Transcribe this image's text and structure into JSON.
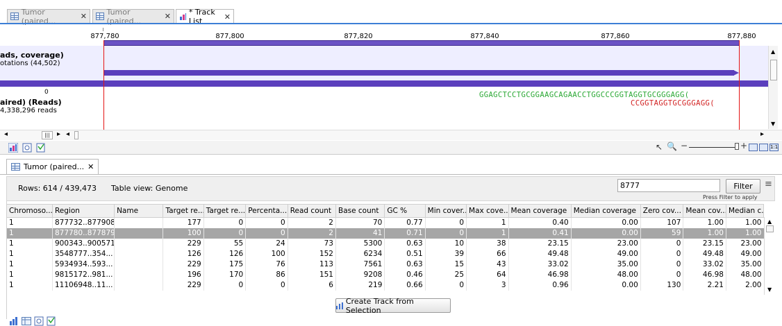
{
  "tabs": [
    {
      "label": "Tumor (paired...",
      "active": false
    },
    {
      "label": "Tumor (paired...",
      "active": false
    },
    {
      "label": "* Track List",
      "active": true
    }
  ],
  "ruler": {
    "ticks": [
      "877,780",
      "877,800",
      "877,820",
      "877,840",
      "877,860",
      "877,880"
    ]
  },
  "coverage_track": {
    "title": "ads, coverage)",
    "subtitle": "otations (44,502)"
  },
  "reads_track": {
    "title": "aired) (Reads)",
    "subtitle": "4,338,296 reads",
    "axis_zero": "0"
  },
  "sequences": {
    "top": "GGAGCTCCTGCGGAAGCAGAACCTGGCCCGGTAGGTGCGGGAGG(",
    "bottom": "CCGGTAGGTGCGGGAGG("
  },
  "lower_tab": {
    "label": "Tumor (paired..."
  },
  "filter_bar": {
    "rows": "Rows: 614 / 439,473",
    "table_view": "Table view: Genome",
    "search_value": "8777",
    "filter_button": "Filter",
    "hint": "Press Filter to apply"
  },
  "table": {
    "columns": [
      "Chromoso...",
      "Region",
      "Name",
      "Target re...",
      "Target re...",
      "Percenta...",
      "Read count",
      "Base count",
      "GC %",
      "Min cover...",
      "Max cove...",
      "Mean coverage",
      "Median coverage",
      "Zero cov...",
      "Mean cov...",
      "Median c..."
    ],
    "rows": [
      [
        "1",
        "877732..877908",
        "",
        "177",
        "0",
        "0",
        "2",
        "70",
        "0.77",
        "0",
        "1",
        "0.40",
        "0.00",
        "107",
        "1.00",
        "1.00"
      ],
      [
        "1",
        "877780..877879",
        "",
        "100",
        "0",
        "0",
        "2",
        "41",
        "0.71",
        "0",
        "1",
        "0.41",
        "0.00",
        "59",
        "1.00",
        "1.00"
      ],
      [
        "1",
        "900343..900571",
        "",
        "229",
        "55",
        "24",
        "73",
        "5300",
        "0.63",
        "10",
        "38",
        "23.15",
        "23.00",
        "0",
        "23.15",
        "23.00"
      ],
      [
        "1",
        "3548777..354...",
        "",
        "126",
        "126",
        "100",
        "152",
        "6234",
        "0.51",
        "39",
        "66",
        "49.48",
        "49.00",
        "0",
        "49.48",
        "49.00"
      ],
      [
        "1",
        "5934934..593...",
        "",
        "229",
        "175",
        "76",
        "113",
        "7561",
        "0.63",
        "15",
        "43",
        "33.02",
        "35.00",
        "0",
        "33.02",
        "35.00"
      ],
      [
        "1",
        "9815172..981...",
        "",
        "196",
        "170",
        "86",
        "151",
        "9208",
        "0.46",
        "25",
        "64",
        "46.98",
        "48.00",
        "0",
        "46.98",
        "48.00"
      ],
      [
        "1",
        "11106948..11...",
        "",
        "229",
        "0",
        "0",
        "6",
        "219",
        "0.66",
        "0",
        "3",
        "0.96",
        "0.00",
        "130",
        "2.21",
        "2.00"
      ]
    ],
    "selected_row": 1
  },
  "create_button": "Create Track from Selection",
  "icons": [
    "table-icon",
    "track-list-icon",
    "zoom-in-icon",
    "pointer-icon",
    "bar-chart-icon",
    "settings-icon",
    "filter-icon"
  ]
}
